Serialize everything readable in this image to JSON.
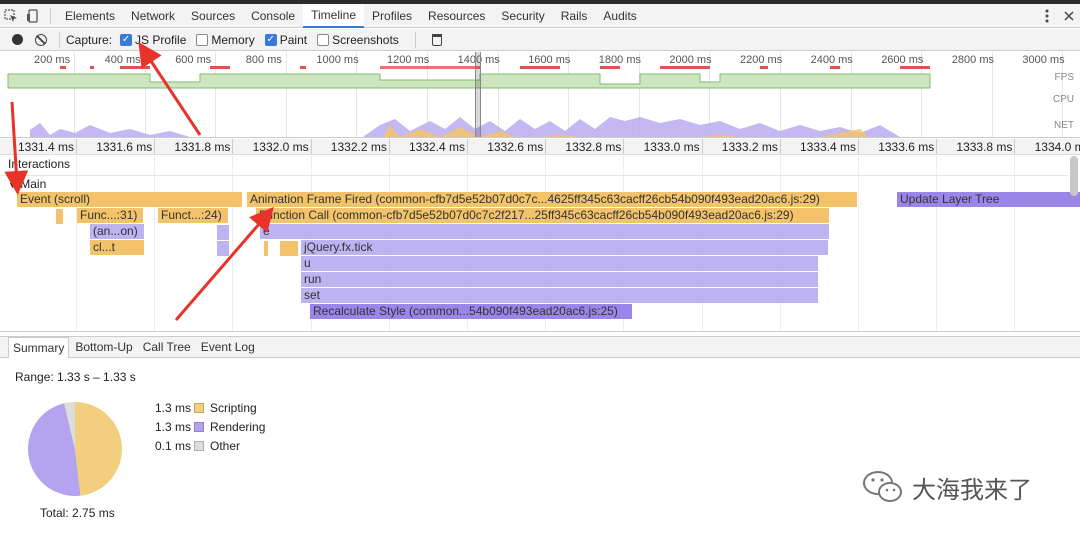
{
  "tabs": [
    "Elements",
    "Network",
    "Sources",
    "Console",
    "Timeline",
    "Profiles",
    "Resources",
    "Security",
    "Rails",
    "Audits"
  ],
  "active_tab": "Timeline",
  "toolbar": {
    "capture_label": "Capture:",
    "options": [
      {
        "label": "JS Profile",
        "checked": true
      },
      {
        "label": "Memory",
        "checked": false
      },
      {
        "label": "Paint",
        "checked": true
      },
      {
        "label": "Screenshots",
        "checked": false
      }
    ]
  },
  "overview": {
    "ticks": [
      "200 ms",
      "400 ms",
      "600 ms",
      "800 ms",
      "1000 ms",
      "1200 ms",
      "1400 ms",
      "1600 ms",
      "1800 ms",
      "2000 ms",
      "2200 ms",
      "2400 ms",
      "2600 ms",
      "2800 ms",
      "3000 ms"
    ],
    "tracks": [
      "FPS",
      "CPU",
      "NET"
    ]
  },
  "ruler": {
    "ticks": [
      "1331.4 ms",
      "1331.6 ms",
      "1331.8 ms",
      "1332.0 ms",
      "1332.2 ms",
      "1332.4 ms",
      "1332.6 ms",
      "1332.8 ms",
      "1333.0 ms",
      "1333.2 ms",
      "1333.4 ms",
      "1333.6 ms",
      "1333.8 ms",
      "1334.0 ms"
    ]
  },
  "flame": {
    "interactions_label": "Interactions",
    "main_label": "Main",
    "events": [
      {
        "label": "Event (scroll)",
        "color": "y",
        "row": 0
      },
      {
        "label": "Animation Frame Fired (common-cfb7d5e52b07d0c7c...4625ff345c63cacff26cb54b090f493ead20ac6.js:29)",
        "color": "y",
        "row": 0
      },
      {
        "label": "Update Layer Tree",
        "color": "pd",
        "row": 0
      },
      {
        "label": "Func...:31)",
        "color": "y",
        "row": 1
      },
      {
        "label": "Funct...:24)",
        "color": "y",
        "row": 1
      },
      {
        "label": "Function Call (common-cfb7d5e52b07d0c7c2f217...25ff345c63cacff26cb54b090f493ead20ac6.js:29)",
        "color": "y",
        "row": 1
      },
      {
        "label": "(an...on)",
        "color": "p",
        "row": 2
      },
      {
        "label": "e",
        "color": "p",
        "row": 2
      },
      {
        "label": "cl...t",
        "color": "y",
        "row": 3
      },
      {
        "label": "jQuery.fx.tick",
        "color": "p",
        "row": 3
      },
      {
        "label": "u",
        "color": "p",
        "row": 4
      },
      {
        "label": "run",
        "color": "p",
        "row": 5
      },
      {
        "label": "set",
        "color": "p",
        "row": 6
      },
      {
        "label": "Recalculate Style (common...54b090f493ead20ac6.js:25)",
        "color": "pd",
        "row": 7
      }
    ]
  },
  "subtabs": [
    "Summary",
    "Bottom-Up",
    "Call Tree",
    "Event Log"
  ],
  "active_subtab": "Summary",
  "summary": {
    "range": "Range: 1.33 s – 1.33 s",
    "total": "Total: 2.75 ms",
    "legend": [
      {
        "value": "1.3 ms",
        "label": "Scripting",
        "color": "#f2cf7f"
      },
      {
        "value": "1.3 ms",
        "label": "Rendering",
        "color": "#b4a3ee"
      },
      {
        "value": "0.1 ms",
        "label": "Other",
        "color": "#dddddd"
      }
    ]
  },
  "chart_data": {
    "type": "pie",
    "categories": [
      "Scripting",
      "Rendering",
      "Other"
    ],
    "values": [
      1.3,
      1.3,
      0.1
    ],
    "title": "",
    "colors": [
      "#f2cf7f",
      "#b4a3ee",
      "#dddddd"
    ]
  },
  "watermark": "大海我来了"
}
